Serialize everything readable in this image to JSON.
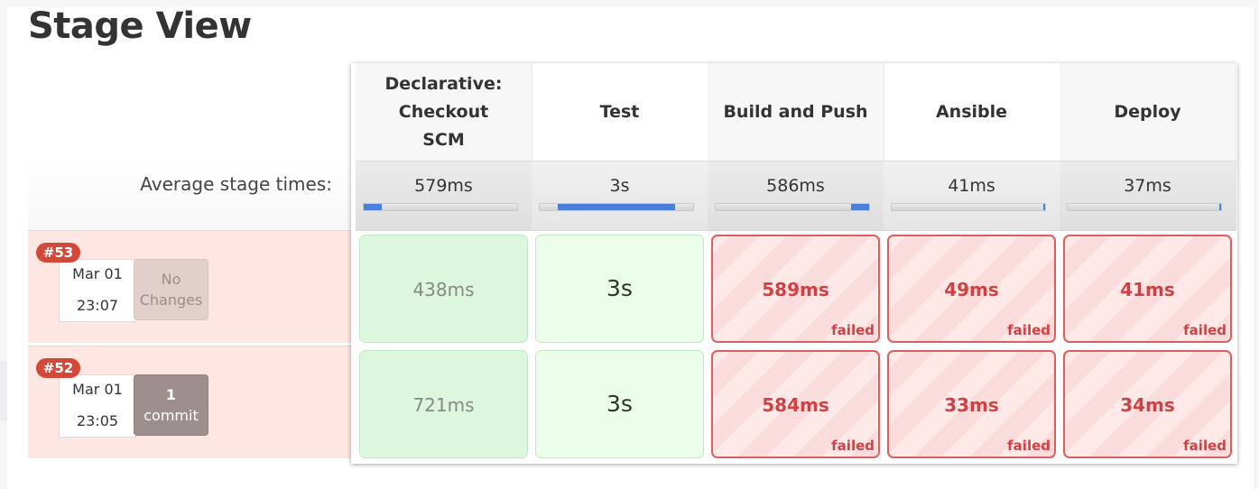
{
  "title": "Stage View",
  "average_label": "Average stage times:",
  "stages": [
    {
      "name": "Declarative: Checkout SCM",
      "avg": "579ms",
      "bar_start": 0.0,
      "bar_end": 0.12
    },
    {
      "name": "Test",
      "avg": "3s",
      "bar_start": 0.12,
      "bar_end": 0.88
    },
    {
      "name": "Build and Push",
      "avg": "586ms",
      "bar_start": 0.88,
      "bar_end": 1.0
    },
    {
      "name": "Ansible",
      "avg": "41ms",
      "bar_start": 0.99,
      "bar_end": 1.0
    },
    {
      "name": "Deploy",
      "avg": "37ms",
      "bar_start": 0.99,
      "bar_end": 1.0
    }
  ],
  "runs": [
    {
      "badge": "#53",
      "date": "Mar 01",
      "time": "23:07",
      "changes_line1": "No",
      "changes_line2": "Changes",
      "changes_type": "none",
      "cells": [
        {
          "duration": "438ms",
          "status": "success",
          "label": ""
        },
        {
          "duration": "3s",
          "status": "success",
          "label": ""
        },
        {
          "duration": "589ms",
          "status": "failed",
          "label": "failed"
        },
        {
          "duration": "49ms",
          "status": "failed",
          "label": "failed"
        },
        {
          "duration": "41ms",
          "status": "failed",
          "label": "failed"
        }
      ]
    },
    {
      "badge": "#52",
      "date": "Mar 01",
      "time": "23:05",
      "changes_line1": "1",
      "changes_line2": "commit",
      "changes_type": "commit",
      "cells": [
        {
          "duration": "721ms",
          "status": "success",
          "label": ""
        },
        {
          "duration": "3s",
          "status": "success",
          "label": ""
        },
        {
          "duration": "584ms",
          "status": "failed",
          "label": "failed"
        },
        {
          "duration": "33ms",
          "status": "failed",
          "label": "failed"
        },
        {
          "duration": "34ms",
          "status": "failed",
          "label": "failed"
        }
      ]
    }
  ],
  "colors": {
    "success": "#ddf7de",
    "failed": "#d14141",
    "badge": "#d24939",
    "bar": "#4a80d9"
  }
}
